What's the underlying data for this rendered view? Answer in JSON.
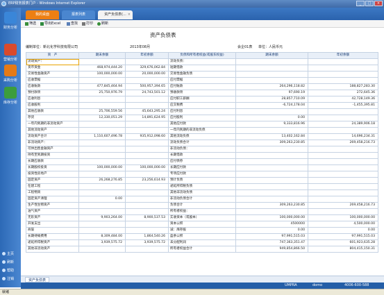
{
  "window": {
    "title": "ERP财务报表门户 - Windows Internet Explorer"
  },
  "window_buttons": [
    "_",
    "□",
    "×"
  ],
  "sidebar": {
    "items": [
      {
        "label": "财务分析",
        "icon": "finance-analysis-icon",
        "color": "#3a86d8"
      },
      {
        "label": "营销分析",
        "icon": "marketing-analysis-icon",
        "color": "#d94a2c"
      },
      {
        "label": "采购分析",
        "icon": "purchase-analysis-icon",
        "color": "#e67a16"
      },
      {
        "label": "库存分析",
        "icon": "inventory-analysis-icon",
        "color": "#3c9d3c"
      }
    ],
    "bottom": [
      {
        "label": "主页",
        "icon": "home-icon"
      },
      {
        "label": "刷新",
        "icon": "refresh-icon"
      },
      {
        "label": "帮助",
        "icon": "help-icon"
      },
      {
        "label": "注销",
        "icon": "logout-icon"
      }
    ]
  },
  "tabs": [
    {
      "label": "我的桌面",
      "color": "#ec7f13"
    },
    {
      "label": "报表列表",
      "color": "#4a86cf"
    },
    {
      "label": "资产负债表(...",
      "color": "#f3f3f3"
    }
  ],
  "tab_close_glyph": "×",
  "toolbar": [
    {
      "label": "筛选",
      "icon": "filter-icon"
    },
    {
      "label": "导出Excel",
      "icon": "excel-icon"
    },
    {
      "label": "查找",
      "icon": "find-icon"
    },
    {
      "label": "打印",
      "icon": "print-icon"
    },
    {
      "label": "刷新",
      "icon": "refresh-icon"
    }
  ],
  "report": {
    "title": "资产负债表",
    "company": "编制单位：新北化学科技有限公司",
    "period": "2013年08月",
    "code": "会企01表",
    "unit": "单位：人民币元",
    "headers": [
      "资　产",
      "期末余额",
      "年初余额",
      "负债和所有者权益(或股东权益)",
      "期末余额",
      "年初余额"
    ],
    "rows": [
      [
        "流动资产：",
        "",
        "",
        "流动负债：",
        "",
        ""
      ],
      [
        "货币资金",
        "468,974,444.20",
        "329,676,062.84",
        "短期借款",
        "",
        ""
      ],
      [
        "交易性金融资产",
        "100,000,000.00",
        "20,000,000.00",
        "交易性金融负债",
        "",
        ""
      ],
      [
        "应收票据",
        "",
        "",
        "应付票据",
        "",
        ""
      ],
      [
        "应收账款",
        "477,845,464.94",
        "500,957,394.65",
        "应付账款",
        "264,296,118.82",
        "188,827,283.30"
      ],
      [
        "预付款项",
        "25,750,976.79",
        "24,743,501.12",
        "预收款项",
        "97,690.19",
        "272,645.36"
      ],
      [
        "应收利息",
        "",
        "",
        "应付职工薪酬",
        "28,857,710.09",
        "42,728,149.36"
      ],
      [
        "应收股利",
        "",
        "",
        "应交税费",
        "-6,724,178.04",
        "-1,455,395.81"
      ],
      [
        "其他应收款",
        "25,706,559.56",
        "45,643,295.24",
        "应付利息",
        "",
        ""
      ],
      [
        "存货",
        "12,330,051.29",
        "14,891,624.95",
        "应付股利",
        "0.00",
        ""
      ],
      [
        "一年内到期的非流动资产",
        "",
        "",
        "其他应付款",
        "9,333,816.96",
        "24,389,906.18"
      ],
      [
        "其他流动资产",
        "",
        "",
        "一年内到期的非流动负债",
        "",
        ""
      ],
      [
        "流动资产合计",
        "1,110,607,496.78",
        "935,912,098.60",
        "其他流动负债",
        "13,402,162.84",
        "14,696,234.31"
      ],
      [
        "非流动资产：",
        "",
        "",
        "流动负债合计",
        "309,263,230.85",
        "269,458,216.73"
      ],
      [
        "可供出售金融资产",
        "",
        "",
        "非流动负债：",
        "",
        ""
      ],
      [
        "持有至到期投资",
        "",
        "",
        "长期借款",
        "",
        ""
      ],
      [
        "长期应收款",
        "",
        "",
        "应付债券",
        "",
        ""
      ],
      [
        "长期股权投资",
        "100,000,000.00",
        "100,000,000.00",
        "长期应付款",
        "",
        ""
      ],
      [
        "投资性房地产",
        "",
        "",
        "专项应付款",
        "",
        ""
      ],
      [
        "固定资产",
        "26,268,276.85",
        "23,256,614.93",
        "预计负债",
        "",
        ""
      ],
      [
        "在建工程",
        "",
        "",
        "递延所得税负债",
        "",
        ""
      ],
      [
        "工程物资",
        "",
        "",
        "其他非流动负债",
        "",
        ""
      ],
      [
        "固定资产清理",
        "0.00",
        "",
        "非流动负债合计",
        "",
        ""
      ],
      [
        "生产性生物资产",
        "",
        "",
        "负债合计",
        "309,263,230.85",
        "269,458,216.73"
      ],
      [
        "油气资产",
        "",
        "",
        "所有者权益：",
        "",
        ""
      ],
      [
        "无形资产",
        "9,903,264.00",
        "8,900,537.53",
        "实收资本（或股本）",
        "100,000,000.00",
        "100,000,000.00"
      ],
      [
        "开发支出",
        "",
        "",
        "资本公积",
        "4500000",
        "4,500,000.00"
      ],
      [
        "商誉",
        "",
        "",
        "减：库存股",
        "0.00",
        "0.00"
      ],
      [
        "长期待摊费用",
        "8,309,484.00",
        "1,864,540.26",
        "盈余公积",
        "97,991,515.03",
        "97,991,515.03"
      ],
      [
        "递延所得税资产",
        "3,939,575.72",
        "3,939,575.72",
        "未分配利润",
        "747,363,351.47",
        "601,923,635.28"
      ],
      [
        "其他非流动资产",
        "",
        "",
        "所有者权益合计",
        "949,854,866.50",
        "804,415,150.31"
      ]
    ]
  },
  "bottom_tab": "资产负债表",
  "status": {
    "user_label": "UMPRA",
    "user": "domo",
    "phone": "4006-600-588"
  },
  "ie_status": "就绪",
  "colors": {
    "sidebar": "#2c69b6",
    "tabbar": "#2a62ad",
    "active_tab": "#ec7f13",
    "table_header": "#e8eff8",
    "grid": "#c5d2e3",
    "highlight": "#e8a200"
  }
}
